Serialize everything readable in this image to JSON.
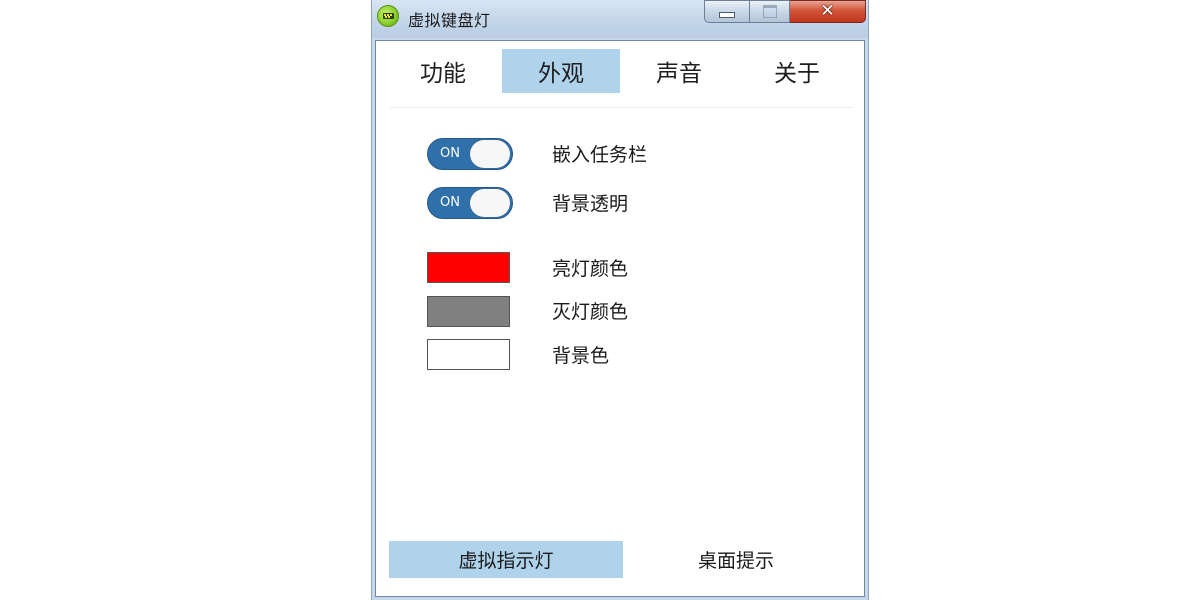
{
  "window": {
    "title": "虚拟键盘灯",
    "app_icon": "keyboard-light-app-icon",
    "controls": {
      "minimize_icon": "minimize-icon",
      "maximize_icon": "maximize-icon",
      "close_icon": "close-icon",
      "close_glyph": "✕"
    }
  },
  "tabs": [
    {
      "label": "功能",
      "active": false
    },
    {
      "label": "外观",
      "active": true
    },
    {
      "label": "声音",
      "active": false
    },
    {
      "label": "关于",
      "active": false
    }
  ],
  "toggles": [
    {
      "state_text": "ON",
      "on": true,
      "label": "嵌入任务栏"
    },
    {
      "state_text": "ON",
      "on": true,
      "label": "背景透明"
    }
  ],
  "colors": [
    {
      "label": "亮灯颜色",
      "value": "#ff0000"
    },
    {
      "label": "灭灯颜色",
      "value": "#808080"
    },
    {
      "label": "背景色",
      "value": "#ffffff"
    }
  ],
  "bottom_tabs": [
    {
      "label": "虚拟指示灯",
      "active": true
    },
    {
      "label": "桌面提示",
      "active": false
    }
  ],
  "theme": {
    "accent": "#b0d3ec",
    "toggle_on": "#2f6faa"
  }
}
